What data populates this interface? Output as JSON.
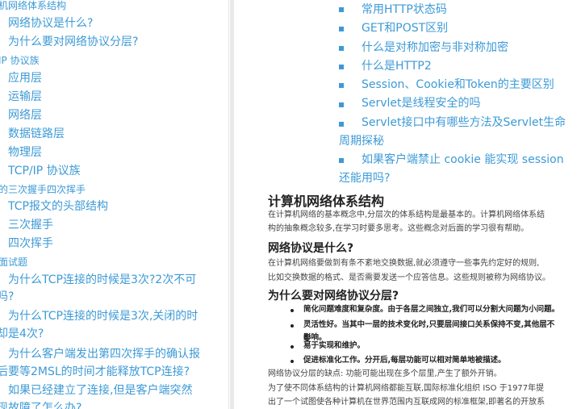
{
  "sidebar": {
    "items": [
      {
        "label": "机网络体系结构",
        "level": 1
      },
      {
        "label": "网络协议是什么?",
        "level": 2
      },
      {
        "label": "为什么要对网络协议分层?",
        "level": 2
      },
      {
        "label": "IP 协议族",
        "level": 1
      },
      {
        "label": "应用层",
        "level": 2
      },
      {
        "label": "运输层",
        "level": 2
      },
      {
        "label": "网络层",
        "level": 2
      },
      {
        "label": "数据链路层",
        "level": 2
      },
      {
        "label": "物理层",
        "level": 2
      },
      {
        "label": "TCP/IP 协议族",
        "level": 2
      },
      {
        "label": "的三次握手四次挥手",
        "level": 1
      },
      {
        "label": "TCP报文的头部结构",
        "level": 2
      },
      {
        "label": "三次握手",
        "level": 2
      },
      {
        "label": "四次挥手",
        "level": 2
      },
      {
        "label": "面试题",
        "level": 1
      },
      {
        "label": "为什么TCP连接的时候是3次?2次不可",
        "level": 2
      },
      {
        "label": "吗?",
        "level": 3
      },
      {
        "label": "为什么TCP连接的时候是3次,关闭的时",
        "level": 2
      },
      {
        "label": "却是4次?",
        "level": 3
      },
      {
        "label": "为什么客户端发出第四次挥手的确认报",
        "level": 2
      },
      {
        "label": "后要等2MSL的时间才能释放TCP连接?",
        "level": 3
      },
      {
        "label": "如果已经建立了连接,但是客户端突然",
        "level": 2
      },
      {
        "label": "现故障了怎么办?",
        "level": 3
      }
    ]
  },
  "main": {
    "links": [
      "常用HTTP状态码",
      "GET和POST区别",
      "什么是对称加密与非对称加密",
      "什么是HTTP2",
      "Session、Cookie和Token的主要区别",
      "Servlet是线程安全的吗",
      "Servlet接口中有哪些方法及Servlet生命",
      "周期探秘",
      "如果客户端禁止 cookie 能实现 session",
      "还能用吗?"
    ],
    "h_arch": "计算机网络体系结构",
    "p_arch_1": "在计算机网络的基本概念中,分层次的体系结构是最基本的。计算机网络体系结",
    "p_arch_2": "构的抽象概念较多,在学习时要多思考。这些概念对后面的学习很有帮助。",
    "h_proto": "网络协议是什么?",
    "p_proto_1": "在计算机网络要做到有条不紊地交换数据,就必须遵守一些事先约定好的规则,",
    "p_proto_2": "比如交换数据的格式、是否需要发送一个应答信息。这些规则被称为网络协议。",
    "h_layer": "为什么要对网络协议分层?",
    "bullets": [
      "简化问题难度和复杂度。由于各层之间独立,我们可以分割大问题为小问题。",
      "灵活性好。当其中一层的技术变化时,只要层间接口关系保持不变,其他层不受",
      "影响。",
      "易于实现和维护。",
      "促进标准化工作。分开后,每层功能可以相对简单地被描述。"
    ],
    "p_weak": "网络协议分层的缺点: 功能可能出现在多个层里,产生了额外开销。",
    "p_iso_1": "为了使不同体系结构的计算机网络都能互联,国际标准化组织 ISO 于1977年提",
    "p_iso_2": "出了一个试图使各种计算机在世界范围内互联成网的标准框架,即著名的开放系"
  }
}
